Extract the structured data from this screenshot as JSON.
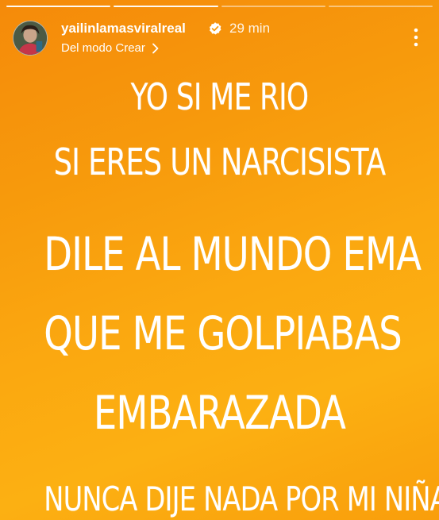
{
  "story": {
    "progress_segments": [
      {
        "state": "done"
      },
      {
        "state": "current"
      },
      {
        "state": "pending"
      },
      {
        "state": "pending"
      }
    ],
    "username": "yailinlamasviralreal",
    "verified_icon": "verified-badge-icon",
    "time": "29 min",
    "source_label": "Del modo Crear",
    "source_chevron_icon": "chevron-right-icon",
    "menu_icon": "more-vertical-icon",
    "background_colors": [
      "#f58a0a",
      "#fcb012"
    ]
  },
  "text_lines": [
    "YO SI ME RIO",
    "SI ERES UN NARCISISTA",
    "DILE AL MUNDO EMA",
    "QUE ME GOLPIABAS",
    "EMBARAZADA",
    "NUNCA DIJE NADA POR MI NIÑA"
  ]
}
